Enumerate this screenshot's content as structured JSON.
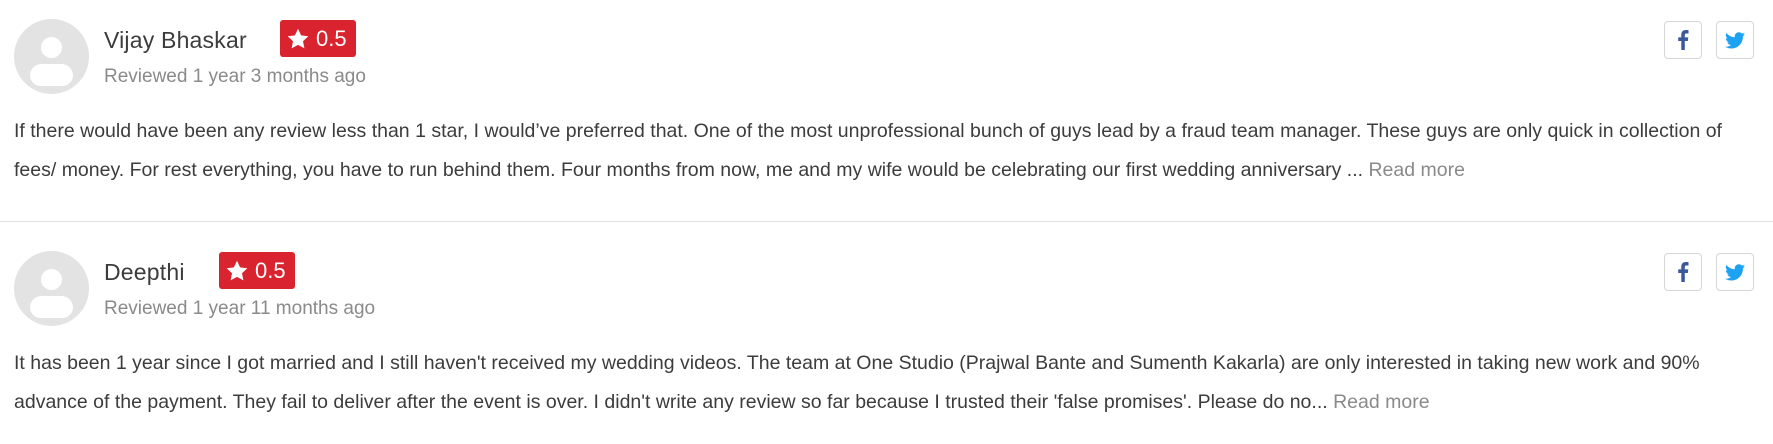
{
  "reviews": [
    {
      "name": "Vijay Bhaskar",
      "rating": "0.5",
      "meta": "Reviewed 1 year 3 months ago",
      "text": "If there would have been any review less than 1 star, I would’ve preferred that. One of the most unprofessional bunch of guys lead by a fraud team manager. These guys are only quick in collection of fees/ money. For rest everything, you have to run behind them. Four months from now, me and my wife would be celebrating our first wedding anniversary ... ",
      "read_more": "Read more"
    },
    {
      "name": "Deepthi",
      "rating": "0.5",
      "meta": "Reviewed 1 year 11 months ago",
      "text": "It has been 1 year since I got married and I still haven't received my wedding videos. The team at One Studio (Prajwal Bante and Sumenth Kakarla) are only interested in taking new work and 90% advance of the payment. They fail to deliver after the event is over. I didn't write any review so far because I trusted their 'false promises'. Please do no... ",
      "read_more": "Read more"
    }
  ],
  "icons": {
    "facebook": "facebook-icon",
    "twitter": "twitter-icon",
    "star": "star-icon",
    "avatar": "user-avatar-icon"
  },
  "colors": {
    "rating_badge": "#d9232e",
    "facebook": "#3b5998",
    "twitter": "#1da1f2",
    "muted_text": "#8a8a8a"
  }
}
